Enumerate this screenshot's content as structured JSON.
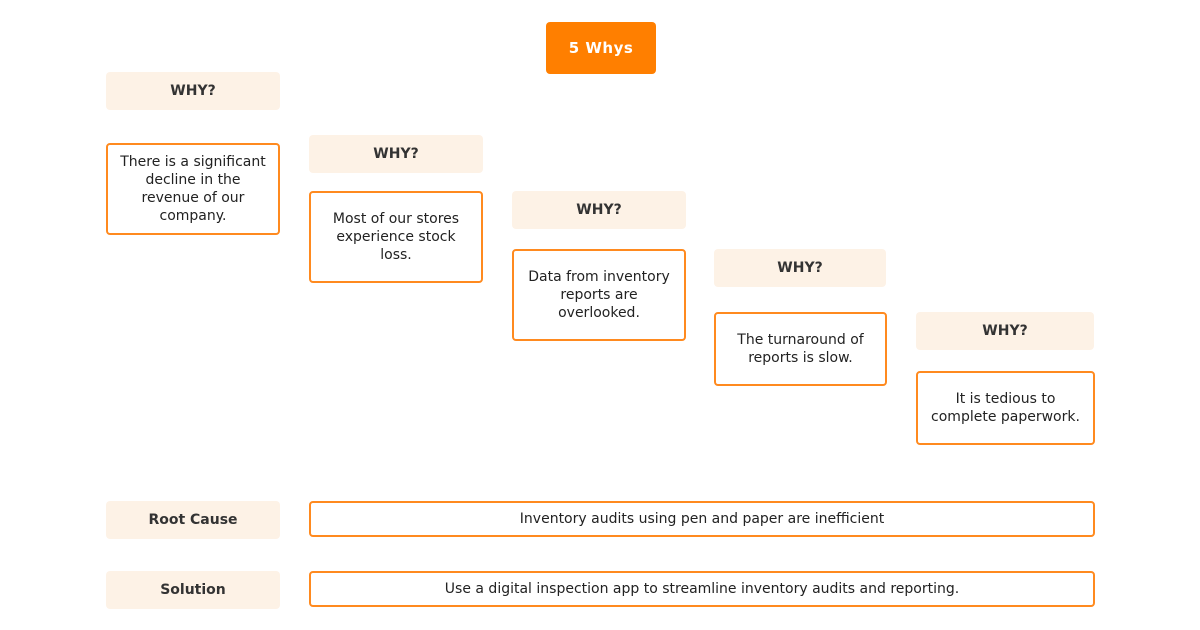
{
  "title": "5 Whys",
  "steps": [
    {
      "why": "WHY?",
      "answer": "There is a significant decline in the revenue of our company."
    },
    {
      "why": "WHY?",
      "answer": "Most of our stores experience stock loss."
    },
    {
      "why": "WHY?",
      "answer": "Data from inventory reports are overlooked."
    },
    {
      "why": "WHY?",
      "answer": "The turnaround of reports is slow."
    },
    {
      "why": "WHY?",
      "answer": "It is tedious to complete paperwork."
    }
  ],
  "root_cause": {
    "label": "Root Cause",
    "text": "Inventory audits using pen and paper are inefficient"
  },
  "solution": {
    "label": "Solution",
    "text": "Use a digital inspection app to streamline inventory audits and reporting."
  },
  "colors": {
    "accent": "#ff7f00",
    "border": "#ff8a1f",
    "label_bg": "#fdf2e6"
  }
}
